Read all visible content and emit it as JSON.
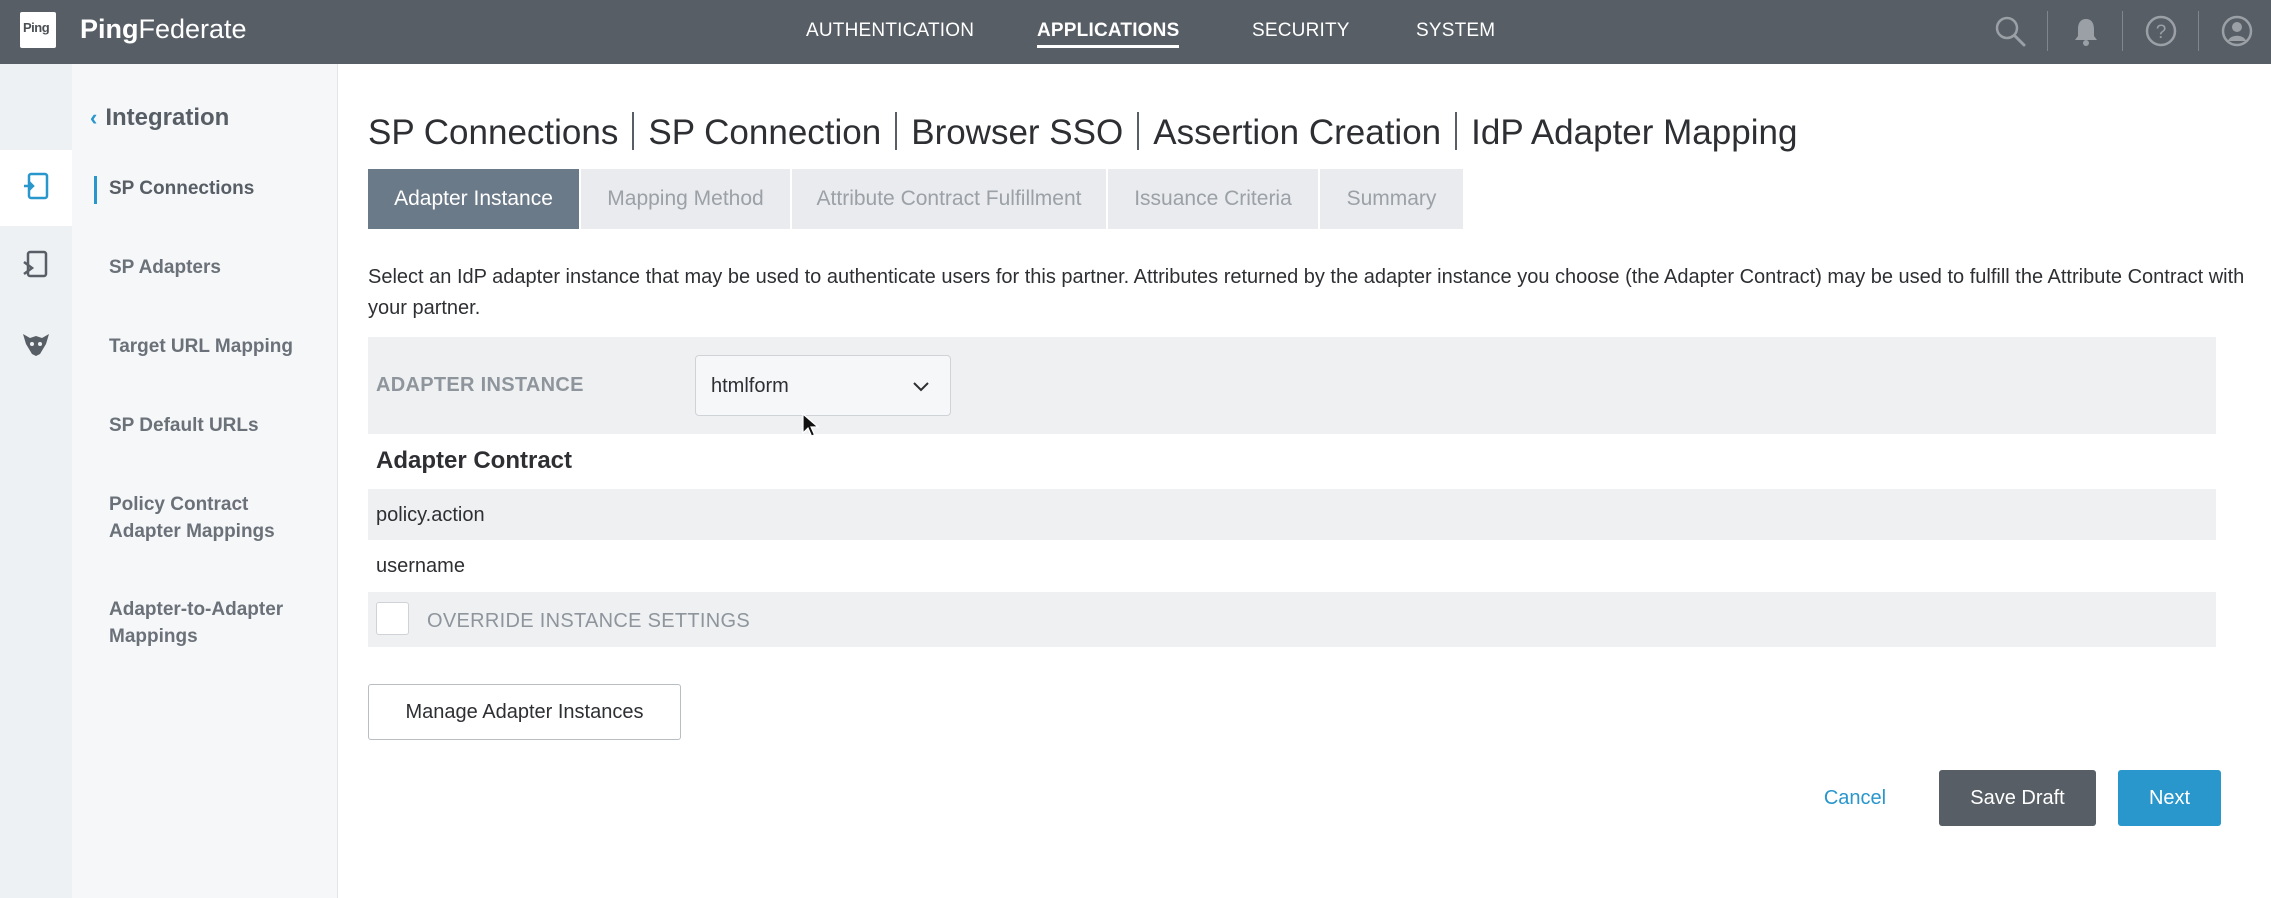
{
  "header": {
    "logo_text": "Ping",
    "brand_bold": "Ping",
    "brand_rest": "Federate",
    "nav": [
      {
        "label": "AUTHENTICATION"
      },
      {
        "label": "APPLICATIONS",
        "active": true
      },
      {
        "label": "SECURITY"
      },
      {
        "label": "SYSTEM"
      }
    ],
    "icons": [
      "search-icon",
      "bell-icon",
      "help-icon",
      "user-icon"
    ]
  },
  "rail": {
    "icons": [
      "applications-icon",
      "adapters-icon",
      "wolf-icon"
    ]
  },
  "sidebar": {
    "back_label": "Integration",
    "items": [
      {
        "label": "SP Connections",
        "active": true
      },
      {
        "label": "SP Adapters"
      },
      {
        "label": "Target URL Mapping"
      },
      {
        "label": "SP Default URLs"
      },
      {
        "label": "Policy Contract Adapter Mappings"
      },
      {
        "label": "Adapter-to-Adapter Mappings"
      }
    ]
  },
  "breadcrumbs": [
    "SP Connections",
    "SP Connection",
    "Browser SSO",
    "Assertion Creation",
    "IdP Adapter Mapping"
  ],
  "tabs": [
    {
      "label": "Adapter Instance",
      "active": true
    },
    {
      "label": "Mapping Method"
    },
    {
      "label": "Attribute Contract Fulfillment"
    },
    {
      "label": "Issuance Criteria"
    },
    {
      "label": "Summary"
    }
  ],
  "description": "Select an IdP adapter instance that may be used to authenticate users for this partner. Attributes returned by the adapter instance you choose (the Adapter Contract) may be used to fulfill the Attribute Contract with your partner.",
  "adapter_instance": {
    "label": "ADAPTER INSTANCE",
    "selected": "htmlform"
  },
  "adapter_contract": {
    "title": "Adapter Contract",
    "attributes": [
      "policy.action",
      "username"
    ]
  },
  "override": {
    "label": "OVERRIDE INSTANCE SETTINGS",
    "checked": false
  },
  "buttons": {
    "manage": "Manage Adapter Instances",
    "cancel": "Cancel",
    "save_draft": "Save Draft",
    "next": "Next"
  },
  "colors": {
    "topbar": "#575e65",
    "accent": "#2996cc",
    "active_tab": "#6b7a88"
  }
}
